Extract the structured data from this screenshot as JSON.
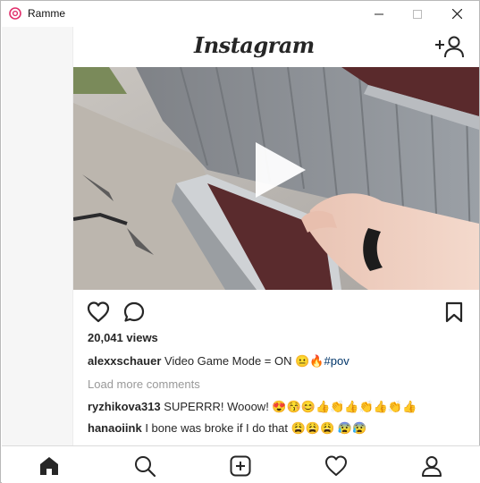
{
  "window": {
    "title": "Ramme",
    "controls": {
      "minimize": "—",
      "maximize": "☐",
      "close": "✕"
    }
  },
  "header": {
    "logo": "Instagram",
    "add_user_icon": "add-user-icon"
  },
  "post": {
    "media": {
      "type": "video",
      "play_icon": "play-icon"
    },
    "actions": {
      "like_icon": "heart-icon",
      "comment_icon": "comment-icon",
      "save_icon": "bookmark-icon"
    },
    "views": "20,041 views",
    "caption": {
      "username": "alexxschauer",
      "text": "Video Game Mode = ON 😐🔥",
      "hashtag": "#pov"
    },
    "load_more": "Load more comments",
    "comments": [
      {
        "username": "ryzhikova313",
        "text": "SUPERRR! Wooow! 😍😚😊👍👏👍👏👍👏👍"
      },
      {
        "username": "hanaoiink",
        "text": "I bone was broke if I do that 😩😩😩 😰😰"
      }
    ]
  },
  "bottom_nav": {
    "items": [
      "home-icon",
      "search-icon",
      "add-post-icon",
      "activity-heart-icon",
      "profile-icon"
    ]
  }
}
